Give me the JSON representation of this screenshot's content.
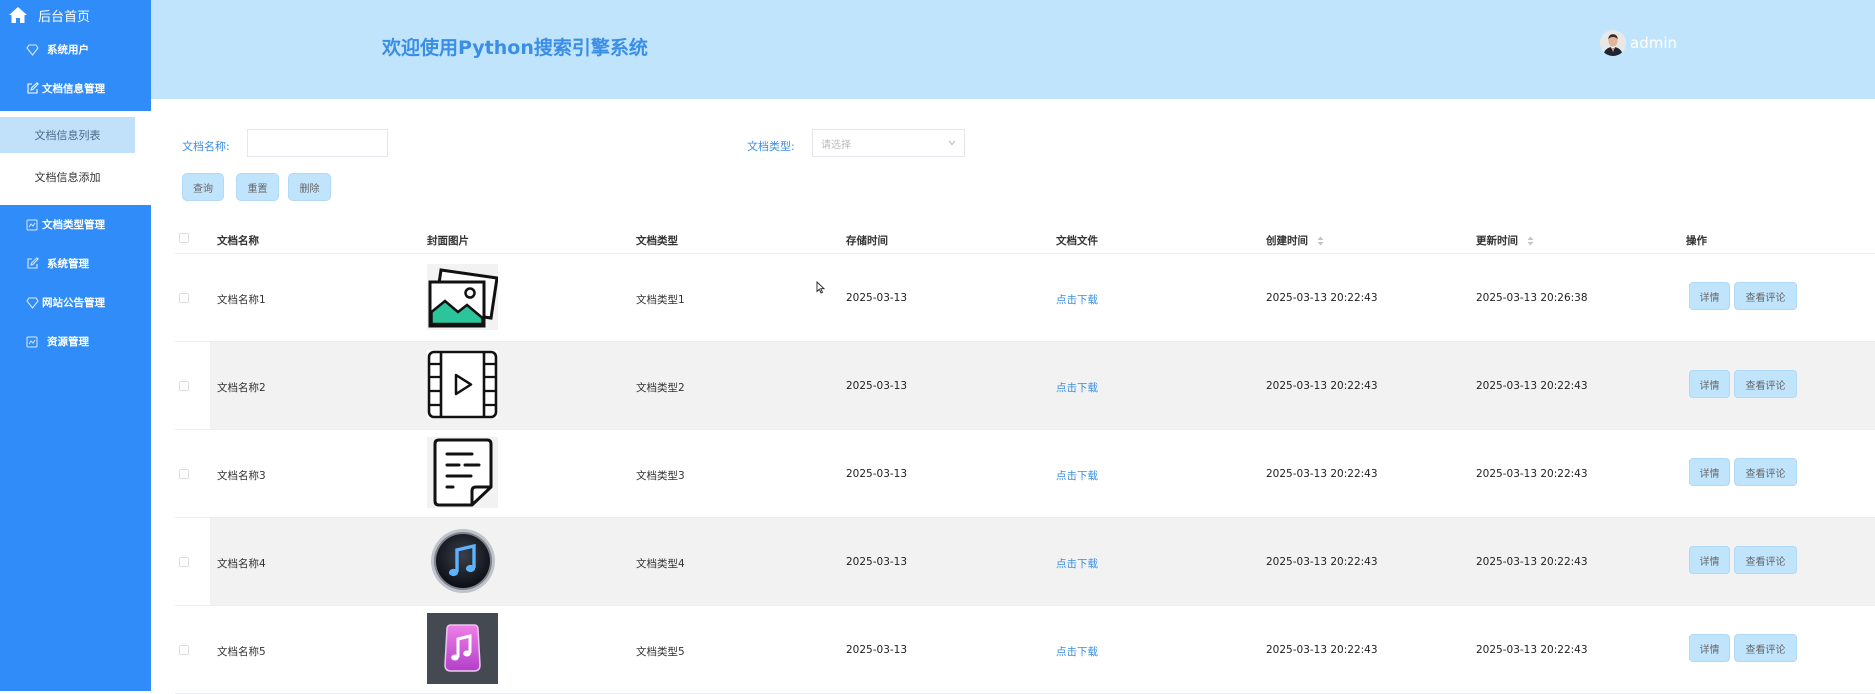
{
  "sidebar": {
    "home": "后台首页",
    "items": [
      {
        "label": "系统用户",
        "icon": "diamond-icon"
      },
      {
        "label": "文档信息管理",
        "icon": "edit-icon"
      },
      {
        "label": "文档类型管理",
        "icon": "chart-icon"
      },
      {
        "label": "系统管理",
        "icon": "edit-icon"
      },
      {
        "label": "网站公告管理",
        "icon": "diamond-icon"
      },
      {
        "label": "资源管理",
        "icon": "chart-icon"
      }
    ],
    "submenu": [
      {
        "label": "文档信息列表",
        "active": true
      },
      {
        "label": "文档信息添加",
        "active": false
      }
    ]
  },
  "header": {
    "title": "欢迎使用Python搜索引擎系统",
    "user": "admin"
  },
  "filters": {
    "name_label": "文档名称:",
    "name_value": "",
    "type_label": "文档类型:",
    "type_placeholder": "请选择"
  },
  "buttons": {
    "query": "查询",
    "reset": "重置",
    "delete": "删除"
  },
  "table": {
    "headers": {
      "name": "文档名称",
      "cover": "封面图片",
      "type": "文档类型",
      "storage_time": "存储时间",
      "file": "文档文件",
      "created": "创建时间",
      "updated": "更新时间",
      "ops": "操作"
    },
    "rows": [
      {
        "name": "文档名称1",
        "cover": "image-icon",
        "type": "文档类型1",
        "storage_time": "2025-03-13",
        "file": "点击下载",
        "created": "2025-03-13 20:22:43",
        "updated": "2025-03-13 20:26:38",
        "detail": "详情",
        "comments": "查看评论"
      },
      {
        "name": "文档名称2",
        "cover": "video-icon",
        "type": "文档类型2",
        "storage_time": "2025-03-13",
        "file": "点击下载",
        "created": "2025-03-13 20:22:43",
        "updated": "2025-03-13 20:22:43",
        "detail": "详情",
        "comments": "查看评论"
      },
      {
        "name": "文档名称3",
        "cover": "document-icon",
        "type": "文档类型3",
        "storage_time": "2025-03-13",
        "file": "点击下载",
        "created": "2025-03-13 20:22:43",
        "updated": "2025-03-13 20:22:43",
        "detail": "详情",
        "comments": "查看评论"
      },
      {
        "name": "文档名称4",
        "cover": "music-icon",
        "type": "文档类型4",
        "storage_time": "2025-03-13",
        "file": "点击下载",
        "created": "2025-03-13 20:22:43",
        "updated": "2025-03-13 20:22:43",
        "detail": "详情",
        "comments": "查看评论"
      },
      {
        "name": "文档名称5",
        "cover": "music-app-icon",
        "type": "文档类型5",
        "storage_time": "2025-03-13",
        "file": "点击下载",
        "created": "2025-03-13 20:22:43",
        "updated": "2025-03-13 20:22:43",
        "detail": "详情",
        "comments": "查看评论"
      }
    ]
  },
  "colors": {
    "sidebar": "#2f8cf8",
    "header": "#c1e4fd",
    "accent": "#3a8ee6",
    "button": "#c1e4fd"
  }
}
